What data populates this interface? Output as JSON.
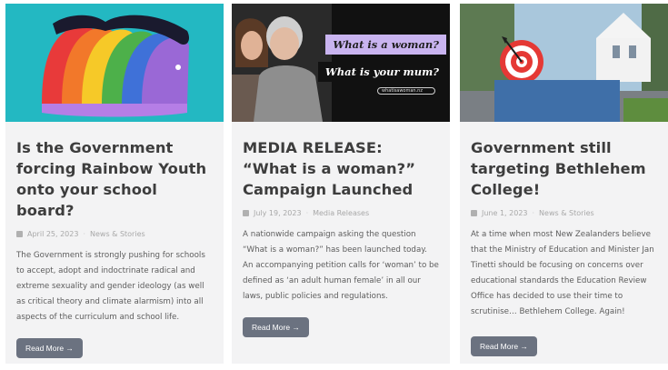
{
  "cards": [
    {
      "title": "Is the Government forcing Rainbow Youth onto your school board?",
      "date": "April 25, 2023",
      "category": "News & Stories",
      "excerpt": "The Government is strongly pushing for schools to accept, adopt and indoctrinate radical and extreme sexuality and gender ideology (as well as critical theory and climate alarmism) into all aspects of the curriculum and school life.",
      "button_label": "Read More →",
      "image_icon": "rainbow-faces-illustration"
    },
    {
      "title": "MEDIA RELEASE: “What is a woman?” Campaign Launched",
      "date": "July 19, 2023",
      "category": "Media Releases",
      "excerpt": "A nationwide campaign asking the question “What is a woman?” has been launched today. An accompanying petition calls for ‘woman’ to be defined as ‘an adult human female’ in all our laws, public policies and regulations.",
      "button_label": "Read More →",
      "image_banner_1": "What is a woman?",
      "image_banner_2": "What is your mum?",
      "image_site": "whatisawoman.nz"
    },
    {
      "title": "Government still targeting Bethlehem College!",
      "date": "June 1, 2023",
      "category": "News & Stories",
      "excerpt": "At a time when most New Zealanders believe that the Ministry of Education and Minister Jan Tinetti should be focusing on concerns over educational standards the Education Review Office has decided to use their time to scrutinise… Bethlehem College. Again!",
      "button_label": "Read More →",
      "image_icon": "target-icon"
    }
  ],
  "colors": {
    "card_bg": "#f3f3f4",
    "title": "#3d3d3d",
    "button_bg": "#6b7280",
    "image1_bg": "#23b8c2",
    "banner_purple": "#c9b4f0"
  }
}
